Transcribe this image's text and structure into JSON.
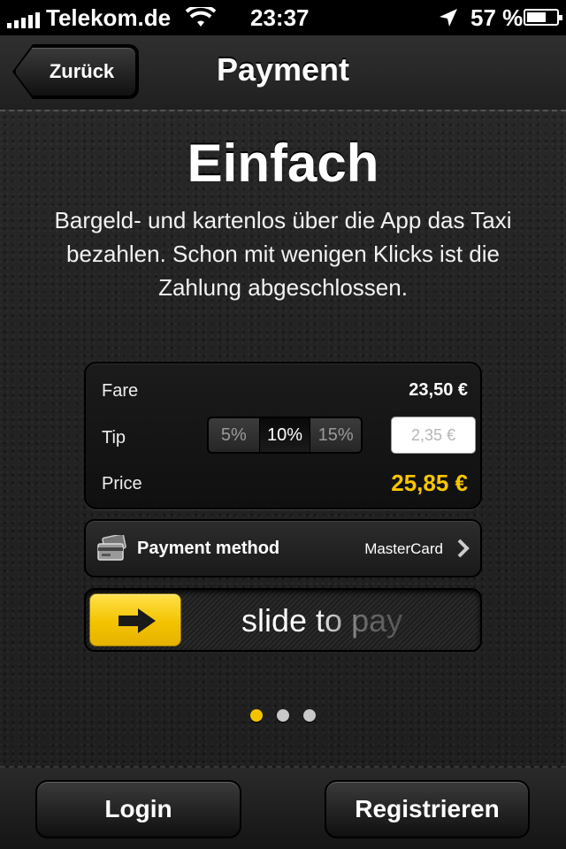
{
  "status_bar": {
    "carrier": "Telekom.de",
    "time": "23:37",
    "battery_percent": "57 %",
    "battery_level": 0.57
  },
  "nav": {
    "back_label": "Zurück",
    "title": "Payment"
  },
  "intro": {
    "headline": "Einfach",
    "description": "Bargeld- und kartenlos über die App das Taxi bezahlen. Schon mit wenigen Klicks ist die Zahlung abgeschlossen."
  },
  "price_card": {
    "fare_label": "Fare",
    "fare_value": "23,50 €",
    "tip_label": "Tip",
    "tip_options": [
      "5%",
      "10%",
      "15%"
    ],
    "tip_selected": "10%",
    "tip_placeholder": "2,35 €",
    "price_label": "Price",
    "price_value": "25,85 €"
  },
  "payment_method": {
    "label": "Payment method",
    "value": "MasterCard"
  },
  "slider": {
    "label": "slide to pay"
  },
  "pager": {
    "count": 3,
    "active_index": 0
  },
  "bottom": {
    "login_label": "Login",
    "register_label": "Registrieren"
  },
  "colors": {
    "accent": "#F4C400",
    "background": "#1E1E1E"
  }
}
